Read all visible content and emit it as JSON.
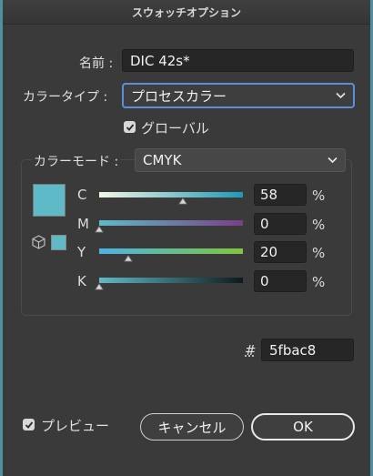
{
  "window": {
    "title": "スウォッチオプション"
  },
  "name": {
    "label": "名前 :",
    "value": "DIC 42s*"
  },
  "color_type": {
    "label": "カラータイプ :",
    "value": "プロセスカラー"
  },
  "global": {
    "label": "グローバル",
    "checked": true
  },
  "color_mode": {
    "label": "カラーモード :",
    "value": "CMYK"
  },
  "swatch_color": "#5fbac8",
  "channels": [
    {
      "label": "C",
      "value": "58",
      "unit": "%",
      "level": 58
    },
    {
      "label": "M",
      "value": "0",
      "unit": "%",
      "level": 0
    },
    {
      "label": "Y",
      "value": "20",
      "unit": "%",
      "level": 20
    },
    {
      "label": "K",
      "value": "0",
      "unit": "%",
      "level": 0
    }
  ],
  "hex": {
    "label": "#",
    "value": "5fbac8"
  },
  "preview": {
    "label": "プレビュー",
    "checked": true
  },
  "buttons": {
    "cancel": "キャンセル",
    "ok": "OK"
  },
  "colors": {
    "accent": "#5b8fd8",
    "swatch": "#5fbac8"
  }
}
